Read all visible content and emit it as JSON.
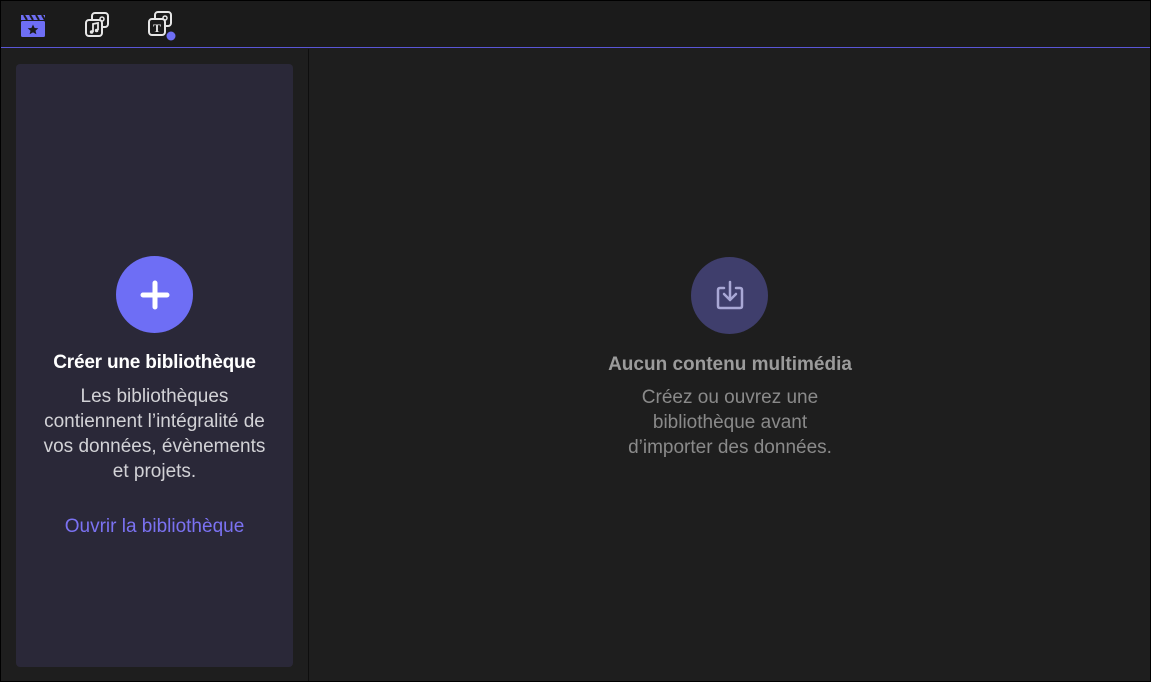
{
  "toolbar": {
    "buttons": [
      {
        "icon": "clapperboard-star-icon",
        "active": true
      },
      {
        "icon": "photos-music-icon",
        "active": false
      },
      {
        "icon": "titles-generators-icon",
        "active": false,
        "badge": true
      }
    ]
  },
  "sidebar": {
    "card": {
      "add_icon": "plus-icon",
      "title": "Créer une bibliothèque",
      "description_lines": [
        "Les bibliothèques",
        "contiennent l’intégralité de",
        "vos données, évènements",
        "et projets."
      ],
      "open_link": "Ouvrir la bibliothèque"
    }
  },
  "main": {
    "empty_state": {
      "icon": "import-icon",
      "title": "Aucun contenu multimédia",
      "description_lines": [
        "Créez ou ouvrez une",
        "bibliothèque avant",
        "d’importer des données."
      ]
    }
  },
  "colors": {
    "accent": "#6e6ef5",
    "link": "#7b72f2",
    "card_bg": "#2a2838",
    "window_bg": "#1e1e1e"
  }
}
